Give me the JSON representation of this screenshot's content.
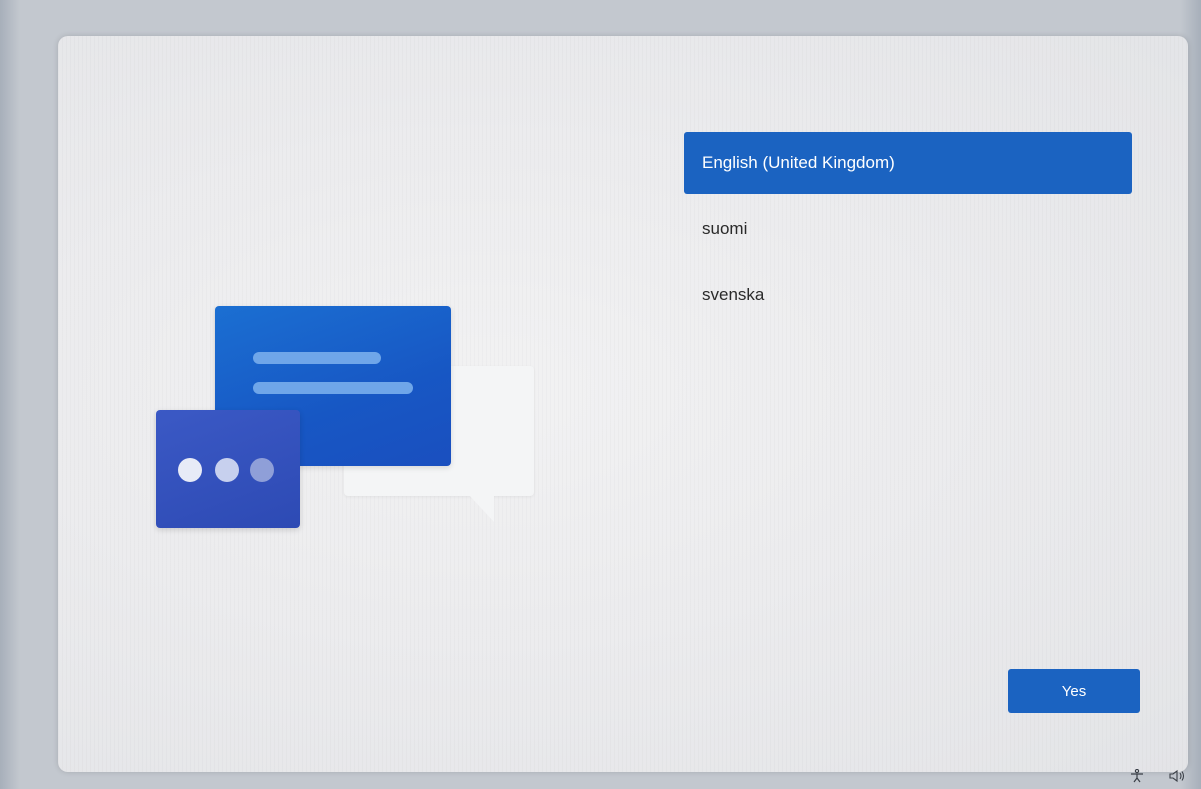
{
  "languages": {
    "items": [
      {
        "label": "English (United Kingdom)",
        "selected": true
      },
      {
        "label": "suomi",
        "selected": false
      },
      {
        "label": "svenska",
        "selected": false
      }
    ]
  },
  "actions": {
    "yes_label": "Yes"
  },
  "tray": {
    "accessibility_icon": "accessibility-icon",
    "volume_icon": "volume-icon"
  },
  "colors": {
    "accent": "#1b63c1",
    "illustration_primary": "#1757c4",
    "illustration_secondary": "#2d4ab4"
  }
}
